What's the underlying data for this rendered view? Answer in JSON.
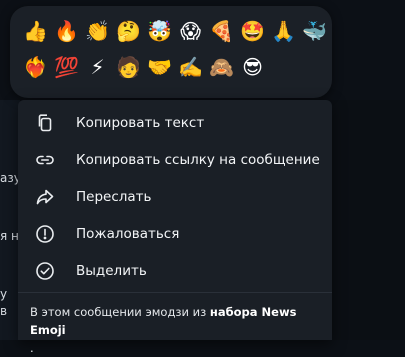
{
  "background": {
    "fragments": [
      "азу",
      "я н",
      "у",
      "в"
    ]
  },
  "reactions": {
    "row1": [
      "👍",
      "🔥",
      "👏",
      "🤔",
      "🤯",
      "😱",
      "🍕",
      "🤩",
      "🙏",
      "🐳"
    ],
    "row2": [
      "❤️‍🔥",
      "💯",
      "⚡",
      "🧑",
      "🤝",
      "✍️",
      "🙈",
      "😎"
    ]
  },
  "menu": {
    "items": [
      {
        "label": "Копировать текст",
        "icon": "copy-icon"
      },
      {
        "label": "Копировать ссылку на сообщение",
        "icon": "link-icon"
      },
      {
        "label": "Переслать",
        "icon": "forward-icon"
      },
      {
        "label": "Пожаловаться",
        "icon": "report-icon"
      },
      {
        "label": "Выделить",
        "icon": "select-icon"
      }
    ],
    "footer": {
      "text": "В этом сообщении эмодзи из ",
      "link": "набора News Emoji",
      "suffix": "."
    }
  },
  "colors": {
    "menu_bg": "#1a1f26",
    "panel_bg": "#1b2027",
    "text": "#f3f5f7"
  }
}
